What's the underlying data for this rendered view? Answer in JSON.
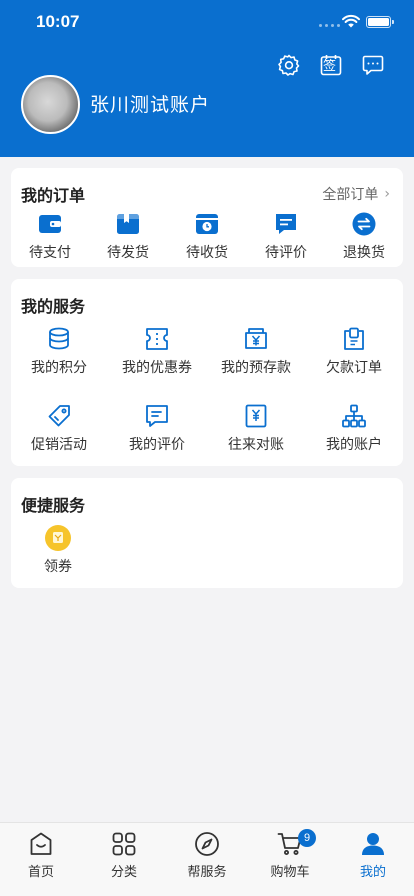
{
  "status_bar": {
    "time": "10:07"
  },
  "header": {
    "username": "张川测试账户",
    "sign_label": "签"
  },
  "orders": {
    "title": "我的订单",
    "all_link": "全部订单",
    "items": [
      {
        "label": "待支付",
        "icon": "wallet-icon"
      },
      {
        "label": "待发货",
        "icon": "box-icon"
      },
      {
        "label": "待收货",
        "icon": "clock-box-icon"
      },
      {
        "label": "待评价",
        "icon": "comment-icon"
      },
      {
        "label": "退换货",
        "icon": "exchange-icon"
      }
    ]
  },
  "services": {
    "title": "我的服务",
    "items": [
      {
        "label": "我的积分",
        "icon": "coins-icon"
      },
      {
        "label": "我的优惠券",
        "icon": "ticket-icon"
      },
      {
        "label": "我的预存款",
        "icon": "yen-wallet-icon"
      },
      {
        "label": "欠款订单",
        "icon": "debt-clipboard-icon"
      },
      {
        "label": "促销活动",
        "icon": "tag-icon"
      },
      {
        "label": "我的评价",
        "icon": "review-icon"
      },
      {
        "label": "往来对账",
        "icon": "yen-doc-icon"
      },
      {
        "label": "我的账户",
        "icon": "org-tree-icon"
      }
    ]
  },
  "quick": {
    "title": "便捷服务",
    "items": [
      {
        "label": "领券",
        "icon": "coupon-icon"
      }
    ]
  },
  "tabbar": {
    "items": [
      {
        "label": "首页",
        "icon": "home-icon"
      },
      {
        "label": "分类",
        "icon": "category-icon"
      },
      {
        "label": "帮服务",
        "icon": "compass-icon"
      },
      {
        "label": "购物车",
        "icon": "cart-icon"
      },
      {
        "label": "我的",
        "icon": "profile-icon"
      }
    ],
    "active": "我的",
    "cart_badge": "9"
  },
  "colors": {
    "brand": "#0a6fcf",
    "background": "#f3f3f5",
    "coupon": "#f6c42b"
  }
}
